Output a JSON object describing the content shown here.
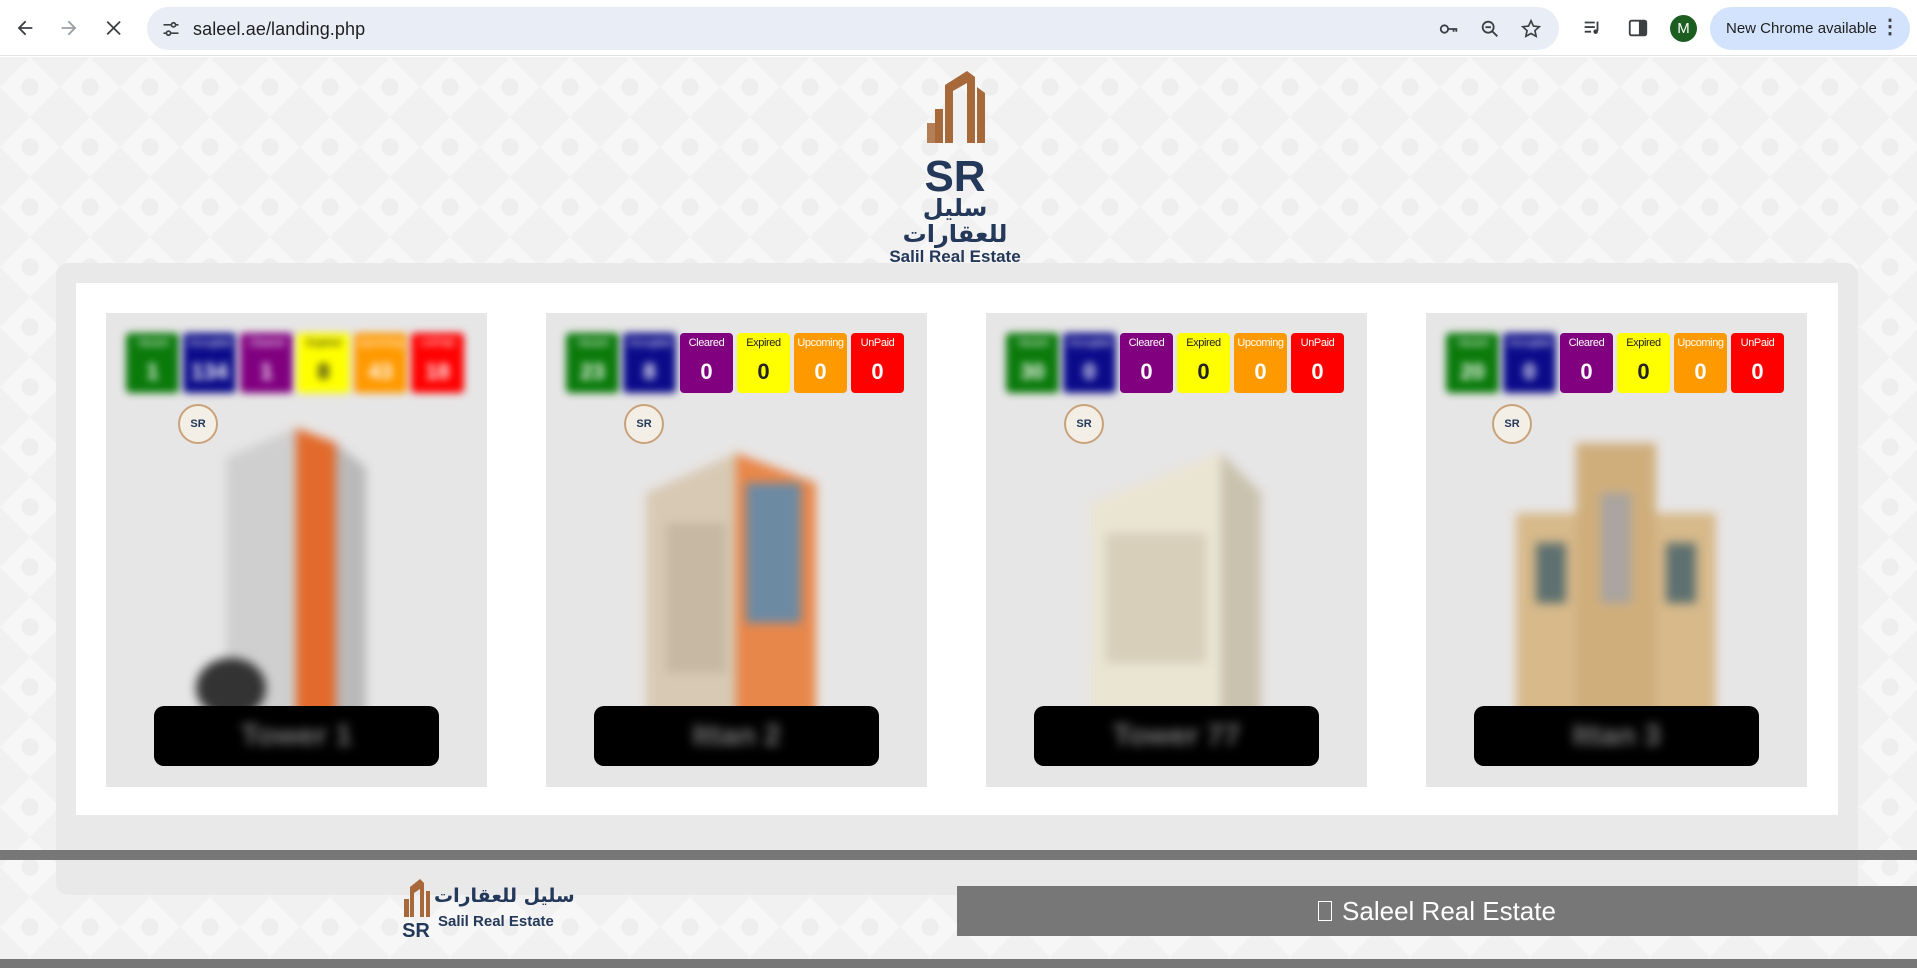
{
  "browser": {
    "url": "saleel.ae/landing.php",
    "profile_initial": "M",
    "update_label": "New Chrome available",
    "icons": {
      "back": "arrow-left-icon",
      "forward": "arrow-right-icon",
      "stop": "close-icon",
      "site_info": "tune-icon",
      "password": "key-icon",
      "zoom": "zoom-icon",
      "bookmark": "star-icon",
      "media": "media-control-icon",
      "side_panel": "side-panel-icon",
      "menu": "more-vert-icon"
    }
  },
  "header": {
    "logo_monogram": "SR",
    "logo_arabic": "سليل للعقارات",
    "logo_english": "Salil Real Estate"
  },
  "status_labels": [
    "Vacant",
    "Occupied",
    "Cleared",
    "Expired",
    "Upcoming",
    "UnPaid"
  ],
  "status_colors": {
    "vacant": "#0a7a0a",
    "occupied": "#0b0b8a",
    "cleared": "#800080",
    "expired": "#ffff00",
    "upcoming": "#ff9900",
    "unpaid": "#ff0000"
  },
  "properties": [
    {
      "name": "Tower 1",
      "counts": {
        "vacant": "1",
        "occupied": "134",
        "cleared": "1",
        "expired": "8",
        "upcoming": "43",
        "unpaid": "18"
      },
      "mini_logo": "SR"
    },
    {
      "name": "Ittan 2",
      "counts": {
        "vacant": "23",
        "occupied": "8",
        "cleared": "0",
        "expired": "0",
        "upcoming": "0",
        "unpaid": "0"
      },
      "mini_logo": "SR"
    },
    {
      "name": "Tower 77",
      "counts": {
        "vacant": "30",
        "occupied": "0",
        "cleared": "0",
        "expired": "0",
        "upcoming": "0",
        "unpaid": "0"
      },
      "mini_logo": "SR"
    },
    {
      "name": "Ittan 3",
      "counts": {
        "vacant": "20",
        "occupied": "0",
        "cleared": "0",
        "expired": "0",
        "upcoming": "0",
        "unpaid": "0"
      },
      "mini_logo": "SR"
    }
  ],
  "footer": {
    "logo_arabic": "سليل للعقارات",
    "logo_english": "Salil Real Estate",
    "brand_text": "Saleel Real Estate",
    "brand_glyph": "unknown-glyph-box"
  }
}
